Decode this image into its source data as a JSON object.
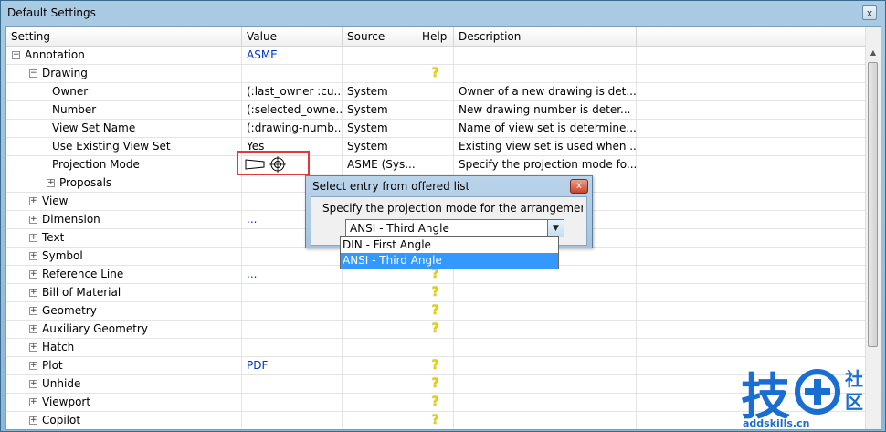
{
  "window": {
    "title": "Default Settings",
    "close_glyph": "x"
  },
  "columns": [
    "Setting",
    "Value",
    "Source",
    "Help",
    "Description"
  ],
  "rows": [
    {
      "indent": 0,
      "toggle": "−",
      "label": "Annotation",
      "value": "ASME",
      "value_blue": true,
      "source": "",
      "help": false,
      "desc": ""
    },
    {
      "indent": 1,
      "toggle": "−",
      "label": "Drawing",
      "value": "",
      "value_blue": false,
      "source": "",
      "help": true,
      "desc": ""
    },
    {
      "indent": 2,
      "toggle": "",
      "label": "Owner",
      "value": "(:last_owner :cu...",
      "value_blue": false,
      "source": "System",
      "help": false,
      "desc": "Owner of a new drawing is det..."
    },
    {
      "indent": 2,
      "toggle": "",
      "label": "Number",
      "value": "(:selected_owne...",
      "value_blue": false,
      "source": "System",
      "help": false,
      "desc": "New drawing number is deter..."
    },
    {
      "indent": 2,
      "toggle": "",
      "label": "View Set Name",
      "value": "(:drawing-numb...",
      "value_blue": false,
      "source": "System",
      "help": false,
      "desc": "Name of view set is determine..."
    },
    {
      "indent": 2,
      "toggle": "",
      "label": "Use Existing View Set",
      "value": "Yes",
      "value_blue": false,
      "source": "System",
      "help": false,
      "desc": "Existing view set is used when ..."
    },
    {
      "indent": 2,
      "toggle": "",
      "label": "Projection Mode",
      "value": "",
      "value_blue": false,
      "source": "ASME (Sys...",
      "help": false,
      "desc": "Specify the projection mode fo..."
    },
    {
      "indent": 2,
      "toggle": "+",
      "label": "Proposals",
      "value": "",
      "value_blue": false,
      "source": "",
      "help": false,
      "desc": ""
    },
    {
      "indent": 1,
      "toggle": "+",
      "label": "View",
      "value": "",
      "value_blue": false,
      "source": "",
      "help": false,
      "desc": ""
    },
    {
      "indent": 1,
      "toggle": "+",
      "label": "Dimension",
      "value": "...",
      "value_blue": true,
      "source": "",
      "help": false,
      "desc": ""
    },
    {
      "indent": 1,
      "toggle": "+",
      "label": "Text",
      "value": "",
      "value_blue": false,
      "source": "",
      "help": false,
      "desc": ""
    },
    {
      "indent": 1,
      "toggle": "+",
      "label": "Symbol",
      "value": "",
      "value_blue": false,
      "source": "",
      "help": false,
      "desc": ""
    },
    {
      "indent": 1,
      "toggle": "+",
      "label": "Reference Line",
      "value": "...",
      "value_blue": true,
      "source": "",
      "help": true,
      "desc": ""
    },
    {
      "indent": 1,
      "toggle": "+",
      "label": "Bill of Material",
      "value": "",
      "value_blue": false,
      "source": "",
      "help": true,
      "desc": ""
    },
    {
      "indent": 1,
      "toggle": "+",
      "label": "Geometry",
      "value": "",
      "value_blue": false,
      "source": "",
      "help": true,
      "desc": ""
    },
    {
      "indent": 1,
      "toggle": "+",
      "label": "Auxiliary Geometry",
      "value": "",
      "value_blue": false,
      "source": "",
      "help": true,
      "desc": ""
    },
    {
      "indent": 1,
      "toggle": "+",
      "label": "Hatch",
      "value": "",
      "value_blue": false,
      "source": "",
      "help": false,
      "desc": ""
    },
    {
      "indent": 1,
      "toggle": "+",
      "label": "Plot",
      "value": "PDF",
      "value_blue": true,
      "source": "",
      "help": true,
      "desc": ""
    },
    {
      "indent": 1,
      "toggle": "+",
      "label": "Unhide",
      "value": "",
      "value_blue": false,
      "source": "",
      "help": true,
      "desc": ""
    },
    {
      "indent": 1,
      "toggle": "+",
      "label": "Viewport",
      "value": "",
      "value_blue": false,
      "source": "",
      "help": true,
      "desc": ""
    },
    {
      "indent": 1,
      "toggle": "+",
      "label": "Copilot",
      "value": "",
      "value_blue": false,
      "source": "",
      "help": true,
      "desc": ""
    }
  ],
  "help_glyph": "?",
  "dialog": {
    "title": "Select entry from offered list",
    "close_glyph": "x",
    "prompt": "Specify the projection mode for the arrangement",
    "selected": "ANSI - Third Angle",
    "arrow_glyph": "▼",
    "options": [
      {
        "label": "DIN - First Angle",
        "selected": false
      },
      {
        "label": "ANSI - Third Angle",
        "selected": true
      }
    ]
  },
  "logo": {
    "char": "技",
    "circle_char": "+",
    "side_chars": [
      "社",
      "区"
    ],
    "url_text": "addskills.cn"
  },
  "colors": {
    "accent_blue": "#0033cc",
    "selection": "#3399ff",
    "highlight": "#e23a3a",
    "logo_blue": "#1b6ed1"
  }
}
